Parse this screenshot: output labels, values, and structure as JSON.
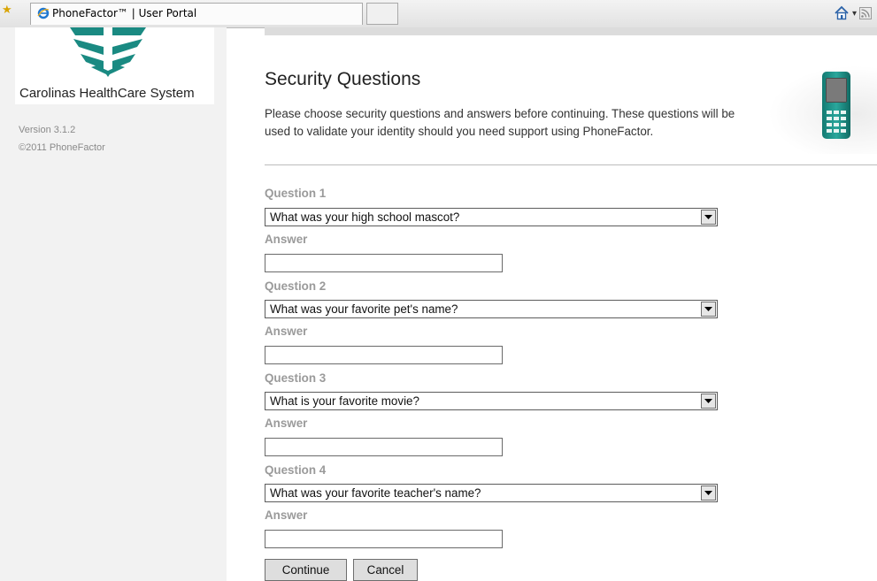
{
  "browser": {
    "tab_title": "PhoneFactor™ | User Portal"
  },
  "sidebar": {
    "org_name": "Carolinas HealthCare System",
    "version": "Version 3.1.2",
    "copyright": "©2011 PhoneFactor"
  },
  "main": {
    "title": "Security Questions",
    "intro": "Please choose security questions and answers before continuing. These questions will be used to validate your identity should you need support using PhoneFactor."
  },
  "questions": [
    {
      "label": "Question 1",
      "selected": "What was your high school mascot?",
      "answer_label": "Answer",
      "answer_value": ""
    },
    {
      "label": "Question 2",
      "selected": "What was your favorite pet's name?",
      "answer_label": "Answer",
      "answer_value": ""
    },
    {
      "label": "Question 3",
      "selected": "What is your favorite movie?",
      "answer_label": "Answer",
      "answer_value": ""
    },
    {
      "label": "Question 4",
      "selected": "What was your favorite teacher's name?",
      "answer_label": "Answer",
      "answer_value": ""
    }
  ],
  "actions": {
    "continue_label": "Continue",
    "cancel_label": "Cancel"
  },
  "colors": {
    "brand_teal": "#1a8a82",
    "sidebar_bg": "#f2f2f2",
    "label_gray": "#9a9a9a"
  },
  "icons": {
    "favorites": "star-icon",
    "tab": "internet-explorer-icon",
    "home": "home-icon",
    "feeds": "rss-feed-icon",
    "logo": "carolinas-healthcare-logo",
    "phone": "mobile-phone-icon",
    "dropdown": "chevron-down-icon"
  }
}
